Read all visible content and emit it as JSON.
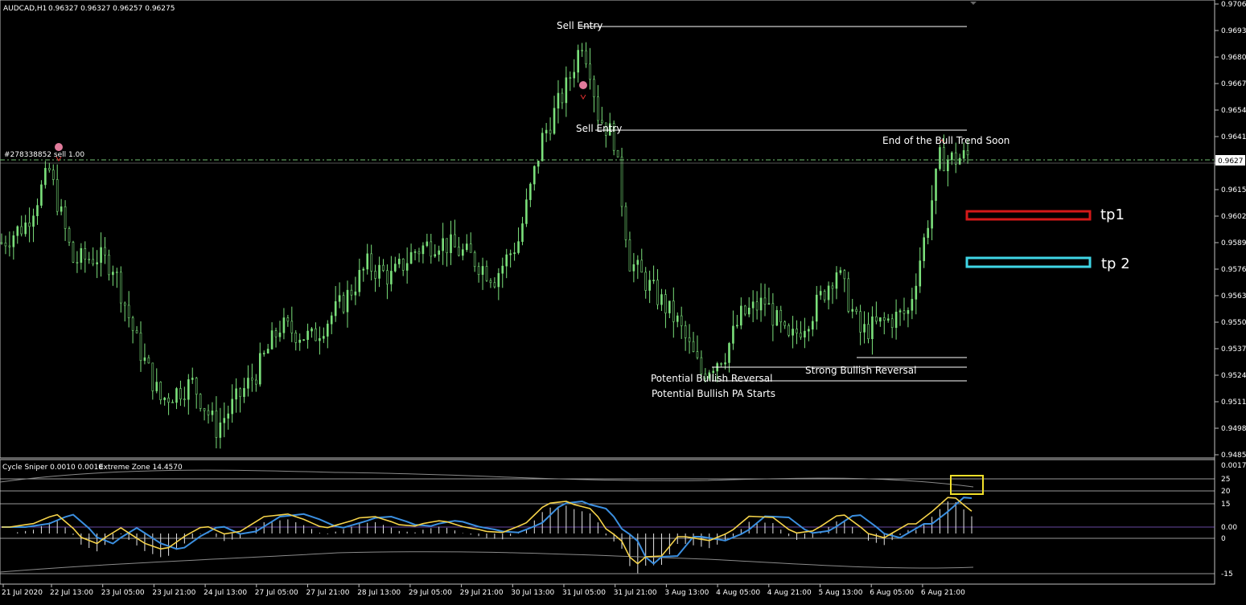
{
  "header": {
    "symbol": "AUDCAD,H1",
    "ohlc": "0.96327 0.96327 0.96257 0.96275",
    "order": "#278338852 sell 1.00"
  },
  "annotations": {
    "sell_entry_1": "Sell Entry",
    "sell_entry_2": "Sell Entry",
    "end_bull": "End of the Bull Trend Soon",
    "potential_reversal": "Potential Bullish Reversal",
    "potential_pa": "Potential Bullish PA Starts",
    "strong_reversal": "Strong Bullish Reversal",
    "tp1": "tp1",
    "tp2": "tp 2"
  },
  "price_axis": {
    "labels": [
      "0.9706",
      "0.9693",
      "0.9680",
      "0.9667",
      "0.9654",
      "0.9641",
      "0.9627",
      "0.9615",
      "0.9602",
      "0.9589",
      "0.9576",
      "0.9563",
      "0.9550",
      "0.9537",
      "0.9524",
      "0.9511",
      "0.9498",
      "0.9485"
    ],
    "current": "0.9627"
  },
  "indicator": {
    "title": "Cycle Sniper 0.0010 0.0010",
    "zone": "Extreme Zone 14.4570",
    "axis_labels": [
      "0.0017",
      "25",
      "20",
      "15",
      "0.00",
      "0",
      "-15"
    ]
  },
  "time_axis": [
    "21 Jul 2020",
    "22 Jul 13:00",
    "23 Jul 05:00",
    "23 Jul 21:00",
    "24 Jul 13:00",
    "27 Jul 05:00",
    "27 Jul 21:00",
    "28 Jul 13:00",
    "29 Jul 05:00",
    "29 Jul 21:00",
    "30 Jul 13:00",
    "31 Jul 05:00",
    "31 Jul 21:00",
    "3 Aug 13:00",
    "4 Aug 05:00",
    "4 Aug 21:00",
    "5 Aug 13:00",
    "6 Aug 05:00",
    "6 Aug 21:00"
  ],
  "colors": {
    "candle": "#7be07b",
    "grid_line": "#ffffff",
    "tp1_box": "#d21919",
    "tp2_box": "#3fd6e6",
    "highlight_box": "#f2e02a",
    "yellow_line": "#f5d34a",
    "blue_line": "#3b8fe0"
  },
  "chart_data": {
    "type": "candlestick",
    "symbol": "AUDCAD",
    "timeframe": "H1",
    "approx_close_path": [
      [
        0,
        0.9589
      ],
      [
        3,
        0.9598
      ],
      [
        6,
        0.9624
      ],
      [
        9,
        0.958
      ],
      [
        12,
        0.9582
      ],
      [
        14,
        0.9578
      ],
      [
        17,
        0.954
      ],
      [
        20,
        0.9512
      ],
      [
        24,
        0.952
      ],
      [
        27,
        0.9498
      ],
      [
        32,
        0.9525
      ],
      [
        35,
        0.9548
      ],
      [
        39,
        0.9542
      ],
      [
        43,
        0.956
      ],
      [
        46,
        0.9578
      ],
      [
        49,
        0.9572
      ],
      [
        52,
        0.9585
      ],
      [
        55,
        0.959
      ],
      [
        59,
        0.9582
      ],
      [
        62,
        0.9572
      ],
      [
        65,
        0.959
      ],
      [
        68,
        0.964
      ],
      [
        71,
        0.9665
      ],
      [
        73,
        0.9688
      ],
      [
        74,
        0.9675
      ],
      [
        75,
        0.9652
      ],
      [
        77,
        0.964
      ],
      [
        79,
        0.958
      ],
      [
        82,
        0.9565
      ],
      [
        85,
        0.955
      ],
      [
        88,
        0.9525
      ],
      [
        91,
        0.9535
      ],
      [
        93,
        0.9553
      ],
      [
        96,
        0.956
      ],
      [
        99,
        0.954
      ],
      [
        102,
        0.9555
      ],
      [
        105,
        0.9576
      ],
      [
        108,
        0.9545
      ],
      [
        111,
        0.955
      ],
      [
        114,
        0.9555
      ],
      [
        116,
        0.959
      ],
      [
        118,
        0.963
      ],
      [
        120,
        0.963
      ],
      [
        122,
        0.9632
      ]
    ]
  }
}
